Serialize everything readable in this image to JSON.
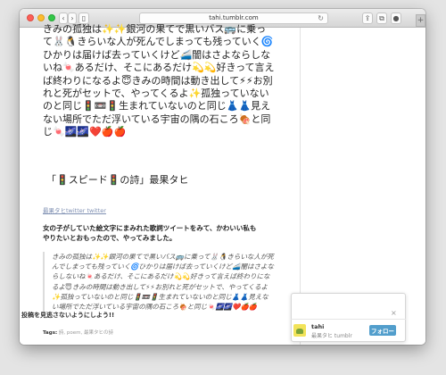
{
  "browser": {
    "url": "tahi.tumblr.com",
    "back_icon": "chevron-left",
    "forward_icon": "chevron-right",
    "sidebar_icon": "sidebar",
    "reload_icon": "reload",
    "share_icon": "share",
    "tabs_icon": "tabs",
    "download_icon": "download",
    "new_tab_icon": "plus"
  },
  "post": {
    "body": "きみの孤独は✨✨銀河の果てで黒いバス🚌に乗って🐰🐧きらいな人が死んでしまっても残っていく🌀ひかりは届けば去っていくけど🚄闇はさよならしないね🍬あるだけ、そこにあるだけ💫💫好きって言えば終わりになるよ😇きみの時間は動き出して⚡⚡お別れと死がセットで、やってくるよ✨孤独っていないのと同じ🚦📼🚦生まれていないのと同じ👗👗見えない場所でただ浮いている宇宙の隅の石ころ🍖と同じ🍬🌌🌌❤️🍎🍎",
    "title": "「🚦スピード🚦の詩」最果タヒ",
    "author_links": "最果タヒtwitter twitter",
    "intro": "女の子がしていた絵文字にまみれた歌詞ツイートをみて、かわいい私もやりたいとおもったので、やってみました。",
    "quote": "きみの孤独は✨✨銀河の果てで黒いバス🚌に乗って🐰🐧きらいな人が死んでしまっても残っていく🌀ひかりは届けば去っていくけど🚄闇はさよならしないね🍬あるだけ、そこにあるだけ💫💫好きって言えば終わりになるよ😇きみの時間は動き出して⚡⚡お別れと死がセットで、やってくるよ✨孤独っていないのと同じ🚦📼🚦生まれていないのと同じ👗👗見えない場所でただ浮いている宇宙の隅の石ころ🍖と同じ🍬🌌🌌❤️🍎🍎",
    "tags_label": "Tags:",
    "tags": "詩, poem, 最果タヒの詩"
  },
  "popup": {
    "title": "投稿を見逃さないようにしよう!!",
    "close": "×",
    "name": "tahi",
    "subtitle": "最果タヒ tumblr",
    "follow_label": "フォロー"
  }
}
